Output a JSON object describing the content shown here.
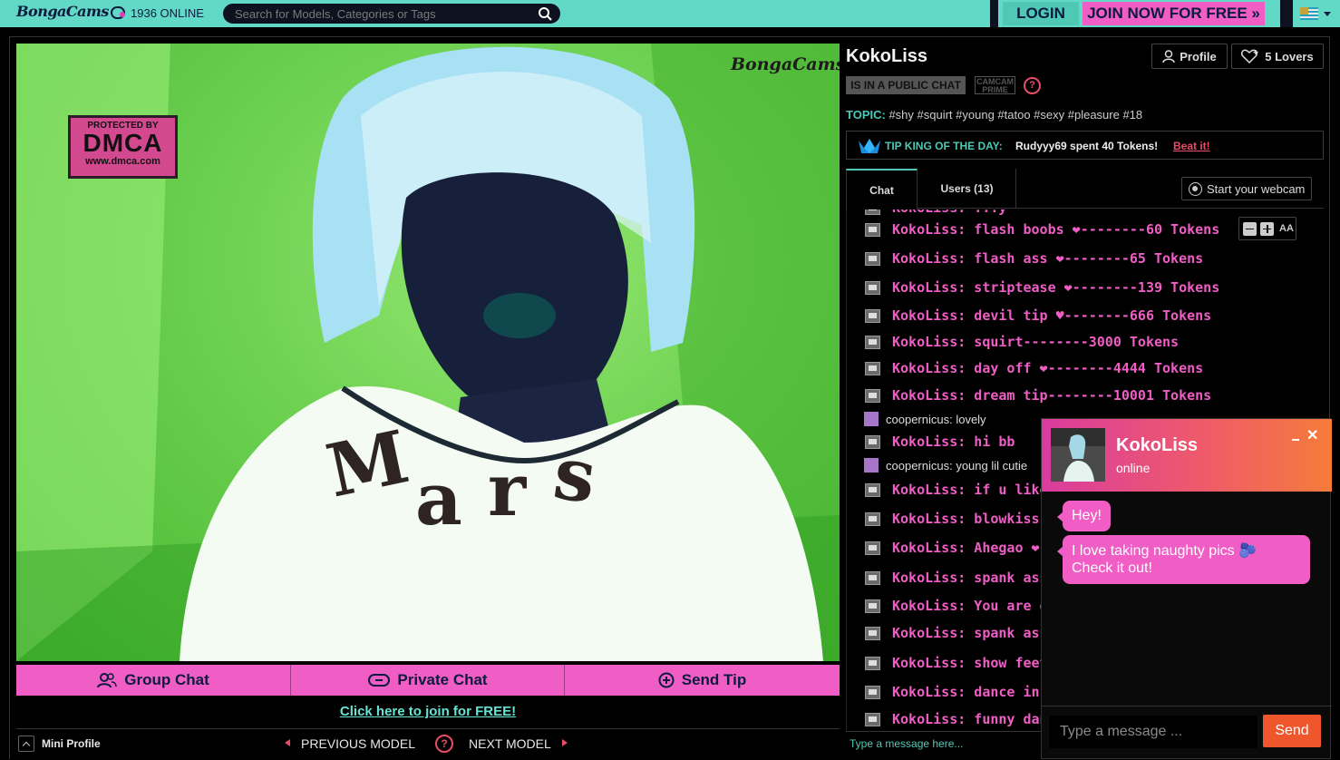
{
  "header": {
    "logo_text": "BongaCams",
    "online_count": "1936 ONLINE",
    "search_placeholder": "Search for Models, Categories or Tags",
    "login_label": "LOGIN",
    "join_label": "JOIN NOW FOR FREE »"
  },
  "video": {
    "dmca_line1": "PROTECTED BY",
    "dmca_line2": "DMCA",
    "dmca_line3": "www.dmca.com",
    "watermark": "BongaCams"
  },
  "actions": {
    "group_chat": "Group Chat",
    "private_chat": "Private Chat",
    "send_tip": "Send Tip",
    "join_link": "Click here to join for FREE!"
  },
  "footer_nav": {
    "mini_profile": "Mini Profile",
    "previous": "PREVIOUS MODEL",
    "help": "?",
    "next": "NEXT MODEL"
  },
  "model": {
    "name": "KokoLiss",
    "profile_label": "Profile",
    "lovers_label": "5 Lovers",
    "status": "IS IN A PUBLIC CHAT",
    "prime_label": "CAMCAM PRIME",
    "help": "?",
    "topic_label": "TOPIC:",
    "topic": "#shy #squirt #young #tatoo #sexy #pleasure #18"
  },
  "tip_king": {
    "label": "TIP KING OF THE DAY:",
    "value": "Rudyyy69 spent 40 Tokens!",
    "action": "Beat it!"
  },
  "tabs": {
    "chat": "Chat",
    "users": "Users (13)",
    "webcam": "Start your webcam"
  },
  "font_control": {
    "aa": "AA"
  },
  "chat_messages": [
    {
      "kind": "model",
      "text": "KokoLiss: flash boobs ❤--------60 Tokens"
    },
    {
      "kind": "model",
      "text": "KokoLiss: flash ass  ❤--------65 Tokens"
    },
    {
      "kind": "model",
      "text": "KokoLiss: striptease ❤--------139 Tokens"
    },
    {
      "kind": "model",
      "text": "KokoLiss: devil tip  ♥--------666 Tokens"
    },
    {
      "kind": "model",
      "text": "KokoLiss: squirt--------3000 Tokens"
    },
    {
      "kind": "model",
      "text": "KokoLiss: day off  ❤--------4444 Tokens"
    },
    {
      "kind": "model",
      "text": "KokoLiss: dream tip--------10001 Tokens"
    },
    {
      "kind": "user",
      "text": "coopernicus: lovely"
    },
    {
      "kind": "model",
      "text": "KokoLiss: hi bb"
    },
    {
      "kind": "user",
      "text": "coopernicus: young lil cutie"
    },
    {
      "kind": "model",
      "text": "KokoLiss: if u like me"
    },
    {
      "kind": "model",
      "text": "KokoLiss: blowkiss  []-"
    },
    {
      "kind": "model",
      "text": "KokoLiss: Ahegao  ❤-"
    },
    {
      "kind": "model",
      "text": "KokoLiss: spank ass  ❤"
    },
    {
      "kind": "model",
      "text": "KokoLiss: You are gor"
    },
    {
      "kind": "model",
      "text": "KokoLiss: spank ass x"
    },
    {
      "kind": "model",
      "text": "KokoLiss: show feet"
    },
    {
      "kind": "model",
      "text": "KokoLiss: dance in clo"
    },
    {
      "kind": "model",
      "text": "KokoLiss: funny dance"
    }
  ],
  "chat_input": {
    "placeholder": "Type a message here..."
  },
  "popup": {
    "name": "KokoLiss",
    "status": "online",
    "message1": "Hey!",
    "message2": "I love taking naughty pics 🫐 Check it out!",
    "input_placeholder": "Type a message ...",
    "send_label": "Send"
  },
  "colors": {
    "accent_teal": "#61d9c6",
    "accent_pink": "#ef5dc5",
    "accent_red": "#e74d67",
    "send_orange": "#f0562c"
  }
}
